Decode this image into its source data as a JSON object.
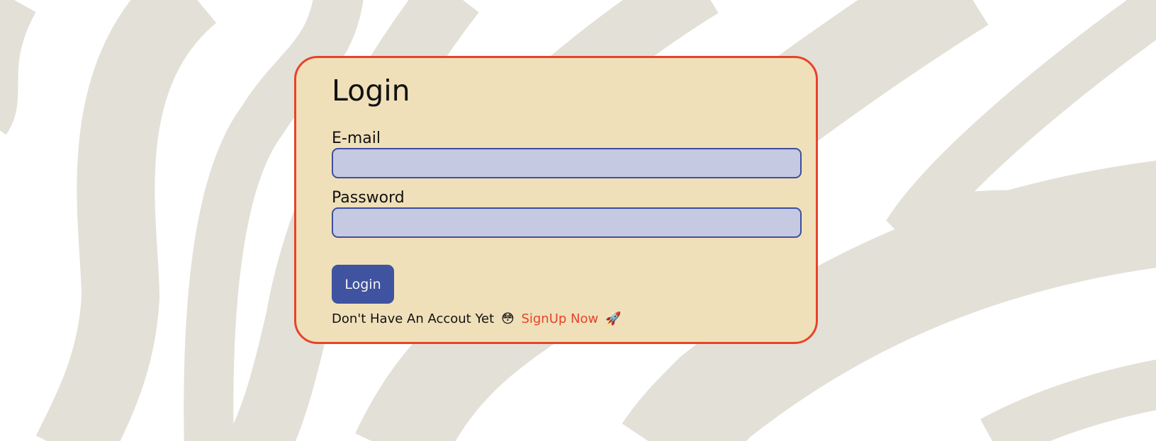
{
  "colors": {
    "page_background": "#ffffff",
    "pattern": "#e3e0d8",
    "card_background": "#efe0b9",
    "card_border": "#e6442a",
    "input_background": "#c5c9e2",
    "input_border": "#3d4f9e",
    "button_background": "#3f53a0",
    "link": "#e6442a"
  },
  "login_form": {
    "title": "Login",
    "email": {
      "label": "E-mail",
      "value": ""
    },
    "password": {
      "label": "Password",
      "value": ""
    },
    "submit_label": "Login",
    "signup_prompt": {
      "text": "Don't Have An Accout Yet",
      "emoji_icon": "flushed-face-icon",
      "link_text": "SignUp Now",
      "link_icon": "rocket-icon"
    }
  }
}
